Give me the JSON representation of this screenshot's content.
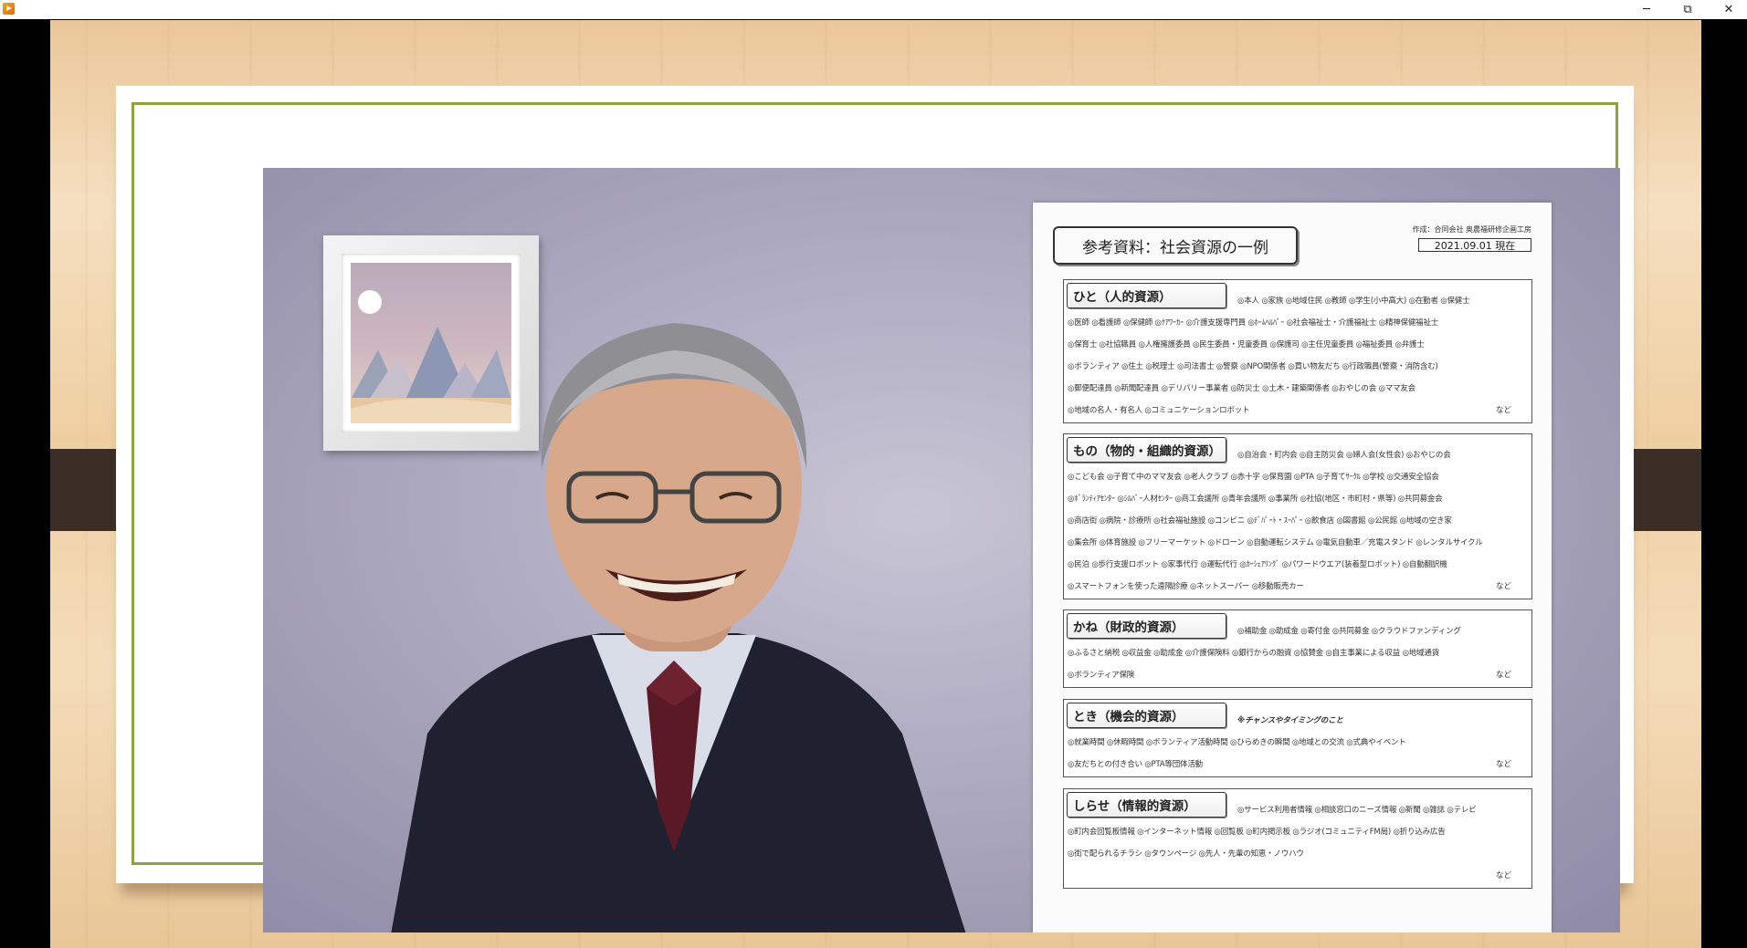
{
  "window": {
    "app_icon": "media-player-icon",
    "controls": {
      "minimize": "─",
      "maximize": "⧉",
      "close": "✕"
    }
  },
  "document": {
    "title": "参考資料：社会資源の一例",
    "author": "作成：合同会社 奥農福研修企画工房",
    "date": "2021.09.01 現在",
    "etc_label": "など",
    "sections": [
      {
        "label": "ひと（人的資源）",
        "lines": [
          "◎本人 ◎家族 ◎地域住民 ◎教師 ◎学生(小中高大) ◎在勤者 ◎保健士",
          "◎医師 ◎看護師 ◎保健師 ◎ｹｱﾜｰｶｰ ◎介護支援専門員 ◎ﾎｰﾑﾍﾙﾊﾟｰ ◎社会福祉士・介護福祉士 ◎精神保健福祉士",
          "◎保育士 ◎社協職員 ◎人権擁護委員 ◎民生委員・児童委員 ◎保護司 ◎主任児童委員 ◎福祉委員 ◎弁護士",
          "◎ボランティア ◎住土 ◎税理士 ◎司法書士 ◎警察 ◎NPO関係者 ◎買い物友だち ◎行政職員(警察・消防含む)",
          "◎郵便配達員 ◎新聞配達員 ◎デリバリー事業者 ◎防災士 ◎土木・建築関係者 ◎おやじの会 ◎ママ友会",
          "◎地域の名人・有名人 ◎コミュニケーションロボット"
        ]
      },
      {
        "label": "もの（物的・組織的資源）",
        "lines": [
          "◎自治会・町内会 ◎自主防災会 ◎婦人会(女性会) ◎おやじの会",
          "◎こども会 ◎子育て中のママ友会 ◎老人クラブ ◎赤十字 ◎保育園 ◎PTA ◎子育てｻｰｸﾙ ◎学校 ◎交通安全協会",
          "◎ﾎﾞﾗﾝﾃｨｱｾﾝﾀｰ ◎ｼﾙﾊﾞｰ人材ｾﾝﾀｰ ◎商工会議所 ◎青年会議所 ◎事業所 ◎社協(地区・市町村・県等) ◎共同募金会",
          "◎商店街 ◎病院・診療所 ◎社会福祉施設 ◎コンビニ ◎ﾃﾞﾊﾟｰﾄ・ｽｰﾊﾟｰ ◎飲食店 ◎図書館 ◎公民館 ◎地域の空き家",
          "◎集会所 ◎体育施設 ◎フリーマーケット ◎ドローン ◎自動運転システム ◎電気自動車／充電スタンド ◎レンタルサイクル",
          "◎民泊 ◎歩行支援ロボット ◎家事代行 ◎運転代行 ◎ｶｰｼｪｱﾘﾝｸﾞ ◎パワードウエア(装着型ロボット) ◎自動翻訳機",
          "◎スマートフォンを使った遠隔診療 ◎ネットスーパー ◎移動販売カー"
        ]
      },
      {
        "label": "かね（財政的資源）",
        "lines": [
          "◎補助金 ◎助成金 ◎寄付金 ◎共同募金 ◎クラウドファンディング",
          "◎ふるさと納税 ◎収益金 ◎助成金 ◎介護保険料 ◎銀行からの融資 ◎協賛金 ◎自主事業による収益 ◎地域通貨",
          "◎ボランティア保険"
        ]
      },
      {
        "label": "とき（機会的資源）",
        "note": "※チャンスやタイミングのこと",
        "lines": [
          "◎就業時間 ◎休暇時間 ◎ボランティア活動時間 ◎ひらめきの瞬間 ◎地域との交流 ◎式典やイベント",
          "◎友だちとの付き合い ◎PTA等団体活動"
        ]
      },
      {
        "label": "しらせ（情報的資源）",
        "lines": [
          "◎サービス利用者情報 ◎相談窓口のニーズ情報 ◎新聞 ◎雑誌 ◎テレビ",
          "◎町内会回覧板情報 ◎インターネット情報 ◎回覧板 ◎町内掲示板 ◎ラジオ(コミュニティFM局) ◎折り込み広告",
          "◎街で配られるチラシ ◎タウンページ ◎先人・先輩の知恵・ノウハウ"
        ]
      }
    ]
  }
}
